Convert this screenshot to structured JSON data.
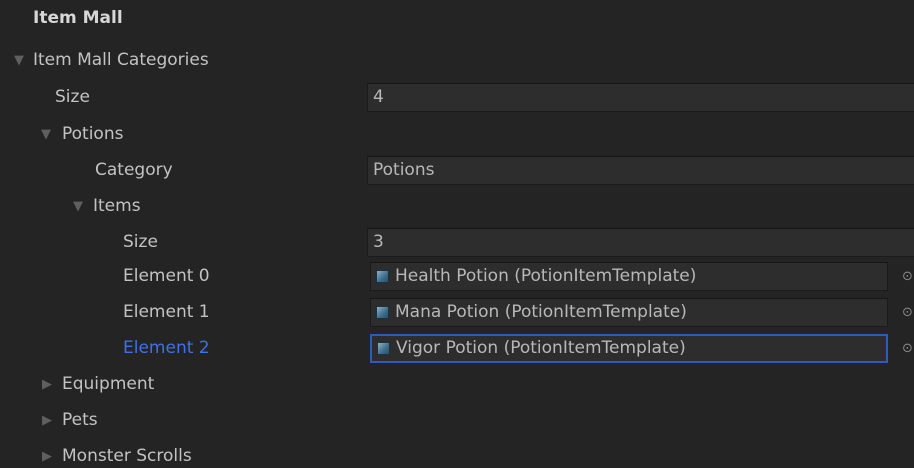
{
  "inspector": {
    "title": "Item Mall",
    "categories_label": "Item Mall Categories",
    "size_label": "Size",
    "size_value": "4",
    "potions": {
      "label": "Potions",
      "category_label": "Category",
      "category_value": "Potions",
      "items_label": "Items",
      "items_size_label": "Size",
      "items_size_value": "3",
      "elements": [
        {
          "label": "Element 0",
          "value": "Health Potion (PotionItemTemplate)"
        },
        {
          "label": "Element 1",
          "value": "Mana Potion (PotionItemTemplate)"
        },
        {
          "label": "Element 2",
          "value": "Vigor Potion (PotionItemTemplate)"
        }
      ]
    },
    "collapsed_categories": [
      "Equipment",
      "Pets",
      "Monster Scrolls"
    ]
  },
  "colors": {
    "panel_bg": "#242424",
    "field_bg": "#2d2d2d",
    "selected_label": "#3d72e8",
    "focus_border": "#2a5db8"
  },
  "icons": {
    "expanded": "triangle-down-icon",
    "collapsed": "triangle-right-icon",
    "object": "scriptable-object-icon",
    "picker": "object-picker-icon"
  }
}
